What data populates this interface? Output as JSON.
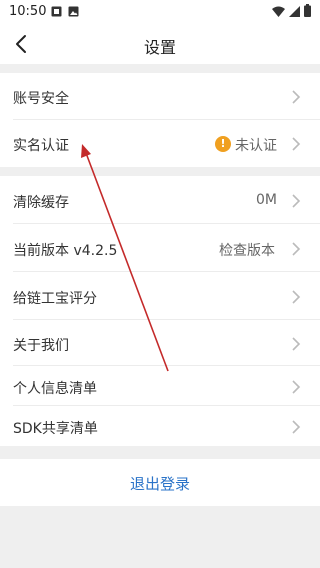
{
  "status_bar": {
    "time": "10:50",
    "icons": [
      "notification-icon",
      "image-icon",
      "wifi-icon",
      "signal-icon",
      "battery-icon"
    ]
  },
  "nav": {
    "title": "设置",
    "back_icon": "back-arrow-icon"
  },
  "group1": {
    "items": [
      {
        "label": "账号安全",
        "value": ""
      },
      {
        "label": "实名认证",
        "value": "未认证",
        "badge_icon": "warning-icon",
        "badge_text": "!"
      }
    ]
  },
  "group2": {
    "items": [
      {
        "label": "清除缓存",
        "value": "0M"
      },
      {
        "label": "当前版本 v4.2.5",
        "value": "检查版本"
      },
      {
        "label": "给链工宝评分",
        "value": ""
      },
      {
        "label": "关于我们",
        "value": ""
      },
      {
        "label": "个人信息清单",
        "value": ""
      },
      {
        "label": "SDK共享清单",
        "value": ""
      }
    ]
  },
  "logout": {
    "label": "退出登录"
  },
  "colors": {
    "accent": "#2a73c8",
    "warning": "#f0a020",
    "annotation_arrow": "#c42a2a",
    "background": "#efefef"
  }
}
